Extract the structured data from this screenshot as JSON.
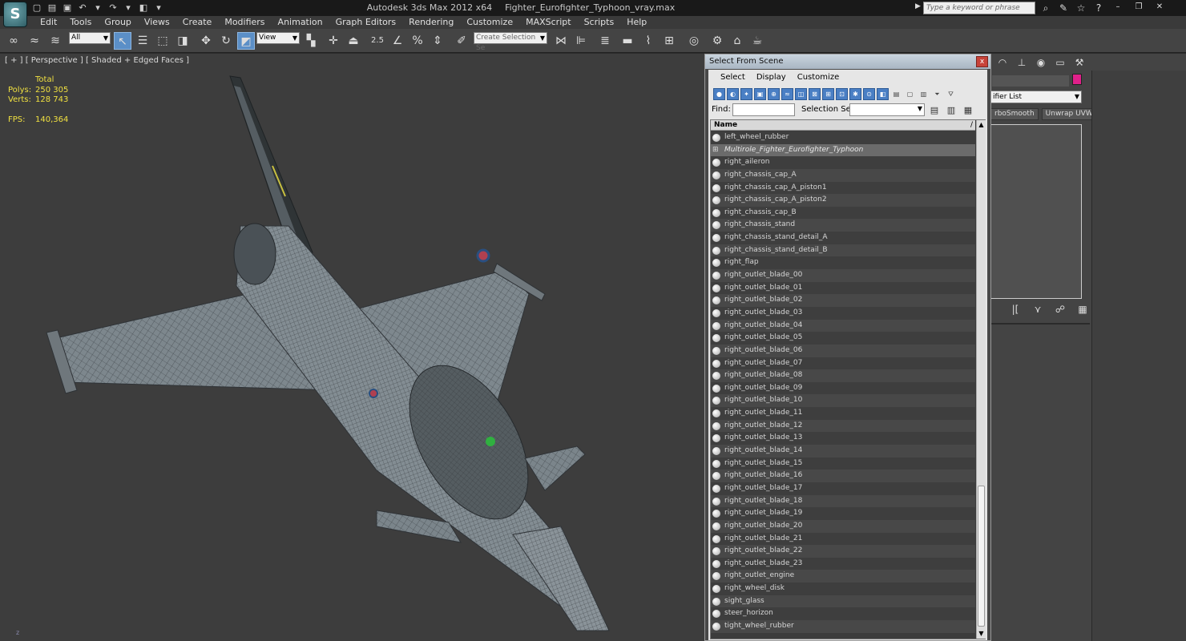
{
  "titlebar": {
    "app_name": "Autodesk 3ds Max  2012 x64",
    "file_name": "Fighter_Eurofighter_Typhoon_vray.max",
    "search_placeholder": "Type a keyword or phrase",
    "logo_glyph": "S"
  },
  "menu": [
    "Edit",
    "Tools",
    "Group",
    "Views",
    "Create",
    "Modifiers",
    "Animation",
    "Graph Editors",
    "Rendering",
    "Customize",
    "MAXScript",
    "Scripts",
    "Help"
  ],
  "toolbar": {
    "selection_filter": "All",
    "reference_coord": "View",
    "named_selection_placeholder": "Create Selection Se",
    "snap_label": "2.5",
    "percent_snap": "%"
  },
  "viewport": {
    "label": "[ + ] [ Perspective ] [ Shaded + Edged Faces ]",
    "stats_header": "Total",
    "polys_label": "Polys:",
    "polys_value": "250 305",
    "verts_label": "Verts:",
    "verts_value": "128 743",
    "fps_label": "FPS:",
    "fps_value": "140,364",
    "axis_label": "z"
  },
  "command_panel": {
    "modifier_list": "ifier List",
    "btn_turbosmooth": "rboSmooth",
    "btn_unwrap": "Unwrap UVW",
    "color_swatch": "#e0208a"
  },
  "dialog": {
    "title": "Select From Scene",
    "close_glyph": "x",
    "menu": [
      "Select",
      "Display",
      "Customize"
    ],
    "find_label": "Find:",
    "find_value": "",
    "selection_set_label": "Selection Set:",
    "selection_set_value": "",
    "column_name": "Name",
    "sort_glyph": "/",
    "highlighted_item": "Multirole_Fighter_Eurofighter_Typhoon",
    "items": [
      "left_wheel_rubber",
      "Multirole_Fighter_Eurofighter_Typhoon",
      "right_aileron",
      "right_chassis_cap_A",
      "right_chassis_cap_A_piston1",
      "right_chassis_cap_A_piston2",
      "right_chassis_cap_B",
      "right_chassis_stand",
      "right_chassis_stand_detail_A",
      "right_chassis_stand_detail_B",
      "right_flap",
      "right_outlet_blade_00",
      "right_outlet_blade_01",
      "right_outlet_blade_02",
      "right_outlet_blade_03",
      "right_outlet_blade_04",
      "right_outlet_blade_05",
      "right_outlet_blade_06",
      "right_outlet_blade_07",
      "right_outlet_blade_08",
      "right_outlet_blade_09",
      "right_outlet_blade_10",
      "right_outlet_blade_11",
      "right_outlet_blade_12",
      "right_outlet_blade_13",
      "right_outlet_blade_14",
      "right_outlet_blade_15",
      "right_outlet_blade_16",
      "right_outlet_blade_17",
      "right_outlet_blade_18",
      "right_outlet_blade_19",
      "right_outlet_blade_20",
      "right_outlet_blade_21",
      "right_outlet_blade_22",
      "right_outlet_blade_23",
      "right_outlet_engine",
      "right_wheel_disk",
      "sight_glass",
      "steer_horizon",
      "tight_wheel_rubber"
    ]
  }
}
